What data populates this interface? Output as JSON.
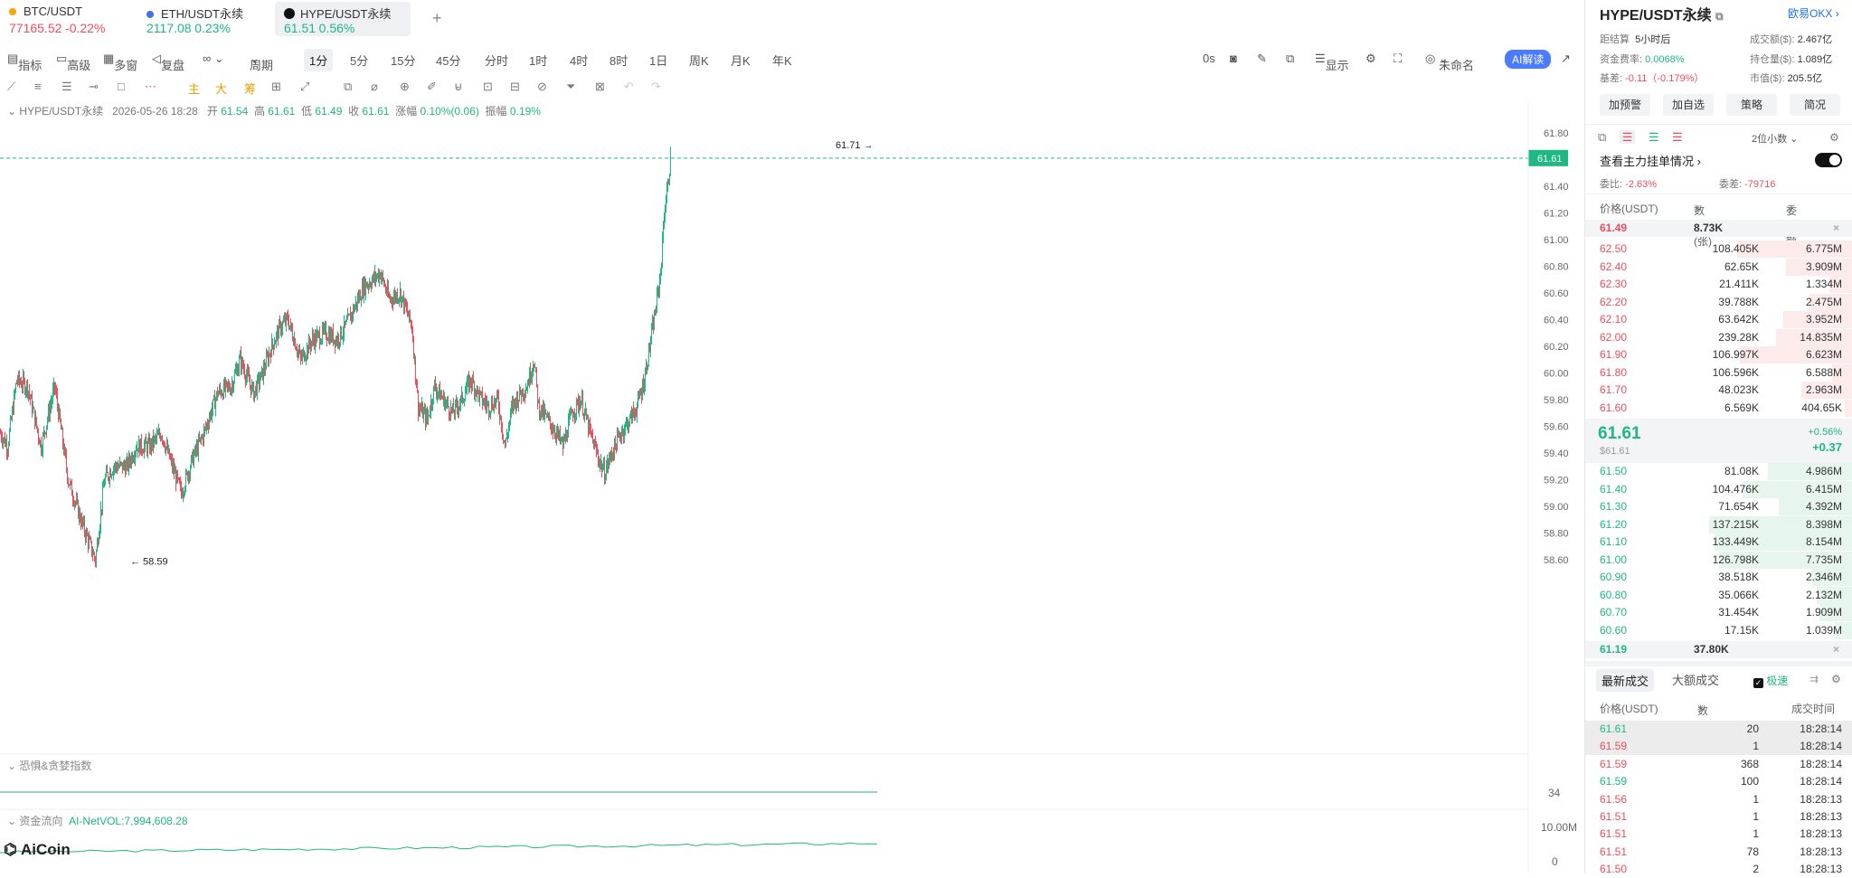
{
  "tabs": [
    {
      "name": "BTC/USDT",
      "price": "77165.52",
      "change": "-0.22%",
      "icon": "bitcoin-icon",
      "dir": "down"
    },
    {
      "name": "ETH/USDT永续",
      "price": "2117.08",
      "change": "0.23%",
      "icon": "ethereum-icon",
      "dir": "up"
    },
    {
      "name": "HYPE/USDT永续",
      "price": "61.51",
      "change": "0.56%",
      "icon": "hype-icon",
      "dir": "up",
      "active": true
    }
  ],
  "add_tab": "+",
  "toolbar": {
    "indicators": "指标",
    "advanced": "高级",
    "multi": "多窗",
    "replay": "复盘",
    "period": "周期",
    "intervals": [
      "1分",
      "5分",
      "15分",
      "45分",
      "分时",
      "1时",
      "4时",
      "8时",
      "1日",
      "周K",
      "月K",
      "年K"
    ],
    "active_interval": "1分",
    "zero_s": "0s",
    "display": "显示",
    "unnamed": "未命名",
    "ai": "AI解读"
  },
  "drawtools": {
    "main": "主",
    "big": "大",
    "chip": "筹"
  },
  "info": {
    "symbol": "HYPE/USDT永续",
    "datetime": "2026-05-26 18:28",
    "open_l": "开",
    "open": "61.54",
    "high_l": "高",
    "high": "61.61",
    "low_l": "低",
    "low": "61.49",
    "close_l": "收",
    "close": "61.61",
    "chg_l": "涨幅",
    "chg": "0.10%(0.06)",
    "amp_l": "振幅",
    "amp": "0.19%"
  },
  "chart_data": {
    "type": "candlestick",
    "ylim": [
      58.5,
      61.9
    ],
    "yticks": [
      "61.80",
      "61.60",
      "61.40",
      "61.20",
      "61.00",
      "60.80",
      "60.60",
      "60.40",
      "60.20",
      "60.00",
      "59.80",
      "59.60",
      "59.40",
      "59.20",
      "59.00",
      "58.80",
      "58.60"
    ],
    "current_price": "61.61",
    "max_label": "61.71",
    "min_label": "58.59",
    "waypoints": [
      [
        0,
        59.55
      ],
      [
        8,
        59.45
      ],
      [
        18,
        59.95
      ],
      [
        30,
        59.9
      ],
      [
        45,
        59.45
      ],
      [
        60,
        59.9
      ],
      [
        75,
        59.2
      ],
      [
        90,
        58.88
      ],
      [
        105,
        58.6
      ],
      [
        115,
        59.2
      ],
      [
        125,
        59.3
      ],
      [
        140,
        59.3
      ],
      [
        150,
        59.45
      ],
      [
        165,
        59.45
      ],
      [
        178,
        59.55
      ],
      [
        190,
        59.3
      ],
      [
        200,
        59.1
      ],
      [
        212,
        59.35
      ],
      [
        225,
        59.55
      ],
      [
        240,
        59.85
      ],
      [
        255,
        59.9
      ],
      [
        265,
        60.1
      ],
      [
        280,
        59.85
      ],
      [
        290,
        60.0
      ],
      [
        300,
        60.2
      ],
      [
        310,
        60.35
      ],
      [
        318,
        60.4
      ],
      [
        332,
        60.1
      ],
      [
        345,
        60.25
      ],
      [
        360,
        60.3
      ],
      [
        372,
        60.25
      ],
      [
        382,
        60.35
      ],
      [
        392,
        60.5
      ],
      [
        402,
        60.65
      ],
      [
        412,
        60.7
      ],
      [
        420,
        60.75
      ],
      [
        430,
        60.55
      ],
      [
        442,
        60.6
      ],
      [
        455,
        60.35
      ],
      [
        462,
        59.75
      ],
      [
        472,
        59.65
      ],
      [
        480,
        59.9
      ],
      [
        490,
        59.8
      ],
      [
        500,
        59.7
      ],
      [
        510,
        59.8
      ],
      [
        520,
        59.95
      ],
      [
        532,
        59.8
      ],
      [
        540,
        59.75
      ],
      [
        550,
        59.8
      ],
      [
        558,
        59.45
      ],
      [
        566,
        59.75
      ],
      [
        575,
        59.85
      ],
      [
        582,
        59.9
      ],
      [
        590,
        60.1
      ],
      [
        595,
        59.75
      ],
      [
        605,
        59.65
      ],
      [
        615,
        59.55
      ],
      [
        622,
        59.45
      ],
      [
        632,
        59.7
      ],
      [
        642,
        59.8
      ],
      [
        652,
        59.55
      ],
      [
        662,
        59.35
      ],
      [
        668,
        59.25
      ],
      [
        676,
        59.4
      ],
      [
        686,
        59.55
      ],
      [
        696,
        59.65
      ],
      [
        704,
        59.75
      ],
      [
        712,
        59.95
      ],
      [
        718,
        60.2
      ],
      [
        724,
        60.45
      ],
      [
        730,
        60.75
      ],
      [
        734,
        61.2
      ],
      [
        738,
        61.4
      ],
      [
        741,
        61.61
      ]
    ],
    "panels": [
      {
        "title": "恐惧&贪婪指数",
        "value_label": "34"
      },
      {
        "title": "资金流向",
        "series": "AI-NetVOL:7,994,608.28",
        "y_label": "10.00M",
        "zero": "0"
      }
    ]
  },
  "watermark": "AiCoin",
  "side": {
    "title": "HYPE/USDT永续",
    "link": "欧易OKX",
    "settle_l": "距结算",
    "settle": "5小时后",
    "turnover_l": "成交额($):",
    "turnover": "2.467亿",
    "funding_l": "资金费率:",
    "funding": "0.0068%",
    "oi_l": "持仓量($):",
    "oi": "1.089亿",
    "basis_l": "基差:",
    "basis": "-0.11（-0.179%）",
    "mcap_l": "市值($):",
    "mcap": "205.5亿",
    "buttons": [
      "加预警",
      "加自选",
      "策略",
      "简况"
    ],
    "decimals": "2位小数",
    "whale": "查看主力挂单情况",
    "wb_l": "委比:",
    "wb": "-2.63%",
    "wc_l": "委差:",
    "wc": "-79716",
    "cols": [
      "价格(USDT)",
      "数量 (张)",
      "委托额"
    ],
    "ask_top": {
      "price": "61.49",
      "qty": "8.73K"
    },
    "asks": [
      {
        "p": "62.50",
        "q": "108.405K",
        "a": "6.775M",
        "w": 0.45
      },
      {
        "p": "62.40",
        "q": "62.65K",
        "a": "3.909M",
        "w": 0.26
      },
      {
        "p": "62.30",
        "q": "21.411K",
        "a": "1.334M",
        "w": 0.09
      },
      {
        "p": "62.20",
        "q": "39.788K",
        "a": "2.475M",
        "w": 0.17
      },
      {
        "p": "62.10",
        "q": "63.642K",
        "a": "3.952M",
        "w": 0.27
      },
      {
        "p": "62.00",
        "q": "239.28K",
        "a": "14.835M",
        "w": 0.3
      },
      {
        "p": "61.90",
        "q": "106.997K",
        "a": "6.623M",
        "w": 0.44
      },
      {
        "p": "61.80",
        "q": "106.596K",
        "a": "6.588M",
        "w": 0.08
      },
      {
        "p": "61.70",
        "q": "48.023K",
        "a": "2.963M",
        "w": 0.2
      },
      {
        "p": "61.60",
        "q": "6.569K",
        "a": "404.65K",
        "w": 0.03
      }
    ],
    "last": "61.61",
    "last_usd": "$61.61",
    "last_pct": "+0.56%",
    "last_chg": "+0.37",
    "bids": [
      {
        "p": "61.50",
        "q": "81.08K",
        "a": "4.986M",
        "w": 0.33
      },
      {
        "p": "61.40",
        "q": "104.476K",
        "a": "6.415M",
        "w": 0.43
      },
      {
        "p": "61.30",
        "q": "71.654K",
        "a": "4.392M",
        "w": 0.29
      },
      {
        "p": "61.20",
        "q": "137.215K",
        "a": "8.398M",
        "w": 0.56
      },
      {
        "p": "61.10",
        "q": "133.449K",
        "a": "8.154M",
        "w": 0.54
      },
      {
        "p": "61.00",
        "q": "126.798K",
        "a": "7.735M",
        "w": 0.52
      },
      {
        "p": "60.90",
        "q": "38.518K",
        "a": "2.346M",
        "w": 0.16
      },
      {
        "p": "60.80",
        "q": "35.066K",
        "a": "2.132M",
        "w": 0.14
      },
      {
        "p": "60.70",
        "q": "31.454K",
        "a": "1.909M",
        "w": 0.13
      },
      {
        "p": "60.60",
        "q": "17.15K",
        "a": "1.039M",
        "w": 0.07
      }
    ],
    "bid_bottom": {
      "price": "61.19",
      "qty": "37.80K"
    },
    "trade_tabs": [
      "最新成交",
      "大额成交"
    ],
    "fast": "极速",
    "trade_cols": [
      "价格(USDT)",
      "数量(张)",
      "成交时间"
    ],
    "trades": [
      {
        "p": "61.61",
        "q": "20",
        "t": "18:28:14",
        "d": "up"
      },
      {
        "p": "61.59",
        "q": "1",
        "t": "18:28:14",
        "d": "down"
      },
      {
        "p": "61.59",
        "q": "368",
        "t": "18:28:14",
        "d": "down"
      },
      {
        "p": "61.59",
        "q": "100",
        "t": "18:28:14",
        "d": "up"
      },
      {
        "p": "61.56",
        "q": "1",
        "t": "18:28:13",
        "d": "down"
      },
      {
        "p": "61.51",
        "q": "1",
        "t": "18:28:13",
        "d": "down"
      },
      {
        "p": "61.51",
        "q": "1",
        "t": "18:28:13",
        "d": "down"
      },
      {
        "p": "61.51",
        "q": "78",
        "t": "18:28:13",
        "d": "down"
      },
      {
        "p": "61.50",
        "q": "2",
        "t": "18:28:13",
        "d": "down"
      }
    ]
  },
  "colors": {
    "up": "#1fb783",
    "down": "#ee4d5c",
    "accent": "#1a73e8",
    "ai": "#4b7bff"
  }
}
